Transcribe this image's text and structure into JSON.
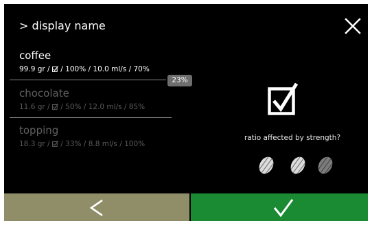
{
  "header": {
    "title": "> display name"
  },
  "ingredients": [
    {
      "name": "coffee",
      "amount": "99.9 gr",
      "params": "/ 100% / 10.0 ml/s / 70%",
      "state": "active"
    },
    {
      "name": "chocolate",
      "amount": "11.6 gr",
      "params": "/ 50% / 12.0 ml/s / 85%",
      "state": "inactive"
    },
    {
      "name": "topping",
      "amount": "18.3 gr",
      "params": "/ 33% / 8.8 ml/s / 100%",
      "state": "inactive"
    }
  ],
  "ratio_badge": "23%",
  "strength": {
    "question": "ratio affected by strength?",
    "checked": true,
    "levels": [
      "light",
      "light",
      "dark"
    ]
  },
  "footer": {
    "back_icon": "chevron-left-icon",
    "confirm_icon": "checkmark-icon"
  },
  "colors": {
    "background": "#000000",
    "back_button": "#8f8e69",
    "confirm_button": "#1a8a33",
    "active_text": "#ffffff",
    "inactive_text": "#5f5f5f",
    "badge": "#6e6e6e"
  }
}
